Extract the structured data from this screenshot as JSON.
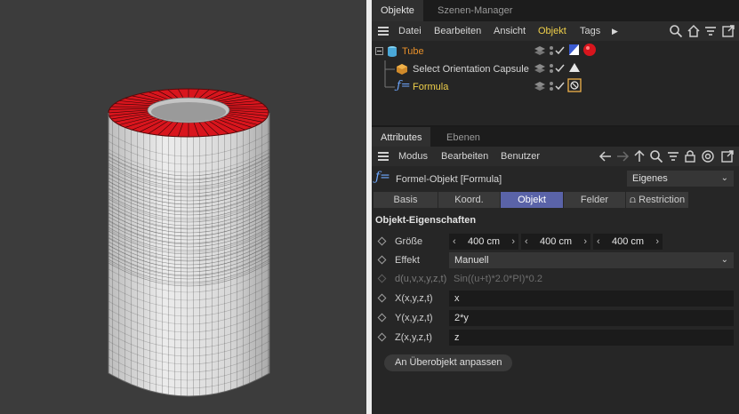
{
  "objects_panel": {
    "tabs": [
      "Objekte",
      "Szenen-Manager"
    ],
    "menu": [
      "Datei",
      "Bearbeiten",
      "Ansicht",
      "Objekt",
      "Tags"
    ],
    "menu_highlight": "Objekt",
    "tree": [
      {
        "name": "Tube",
        "color": "#e8902a",
        "icon": "tube-icon"
      },
      {
        "name": "Select Orientation Capsule",
        "color": "#d6d6d6",
        "icon": "capsule-icon"
      },
      {
        "name": "Formula",
        "color": "#f0d04a",
        "icon": "formula-icon"
      }
    ]
  },
  "attributes_panel": {
    "tabs": [
      "Attributes",
      "Ebenen"
    ],
    "menu": [
      "Modus",
      "Bearbeiten",
      "Benutzer"
    ],
    "object_title": "Formel-Objekt [Formula]",
    "mode_dropdown": "Eigenes",
    "subtabs": [
      "Basis",
      "Koord.",
      "Objekt",
      "Felder",
      "Restriction"
    ],
    "active_subtab": "Objekt",
    "section_title": "Objekt-Eigenschaften",
    "groesse_label": "Größe",
    "groesse_values": [
      "400 cm",
      "400 cm",
      "400 cm"
    ],
    "effekt_label": "Effekt",
    "effekt_value": "Manuell",
    "d_label": "d(u,v,x,y,z,t)",
    "d_value": "Sin((u+t)*2.0*PI)*0.2",
    "x_label": "X(x,y,z,t)",
    "x_value": "x",
    "y_label": "Y(x,y,z,t)",
    "y_value": "2*y",
    "z_label": "Z(x,y,z,t)",
    "z_value": "z",
    "button_label": "An Überobjekt anpassen"
  },
  "colors": {
    "accent": "#5a63a8",
    "highlight": "#f0d04a",
    "tube_label": "#e8902a",
    "cap_red": "#d8151d"
  }
}
